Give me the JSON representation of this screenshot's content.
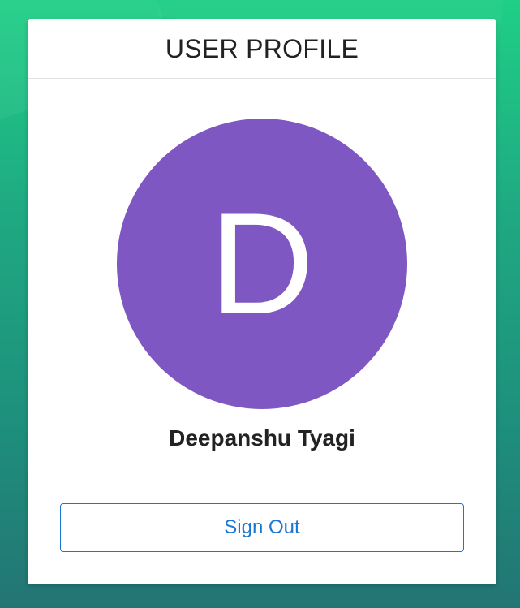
{
  "profile_card": {
    "title": "USER PROFILE",
    "avatar": {
      "initial": "D",
      "background_color": "#7e57c2"
    },
    "user_name": "Deepanshu Tyagi",
    "sign_out_label": "Sign Out"
  },
  "theme": {
    "accent": "#1976d2",
    "background_gradient": [
      "#1fcf86",
      "#237574"
    ]
  }
}
